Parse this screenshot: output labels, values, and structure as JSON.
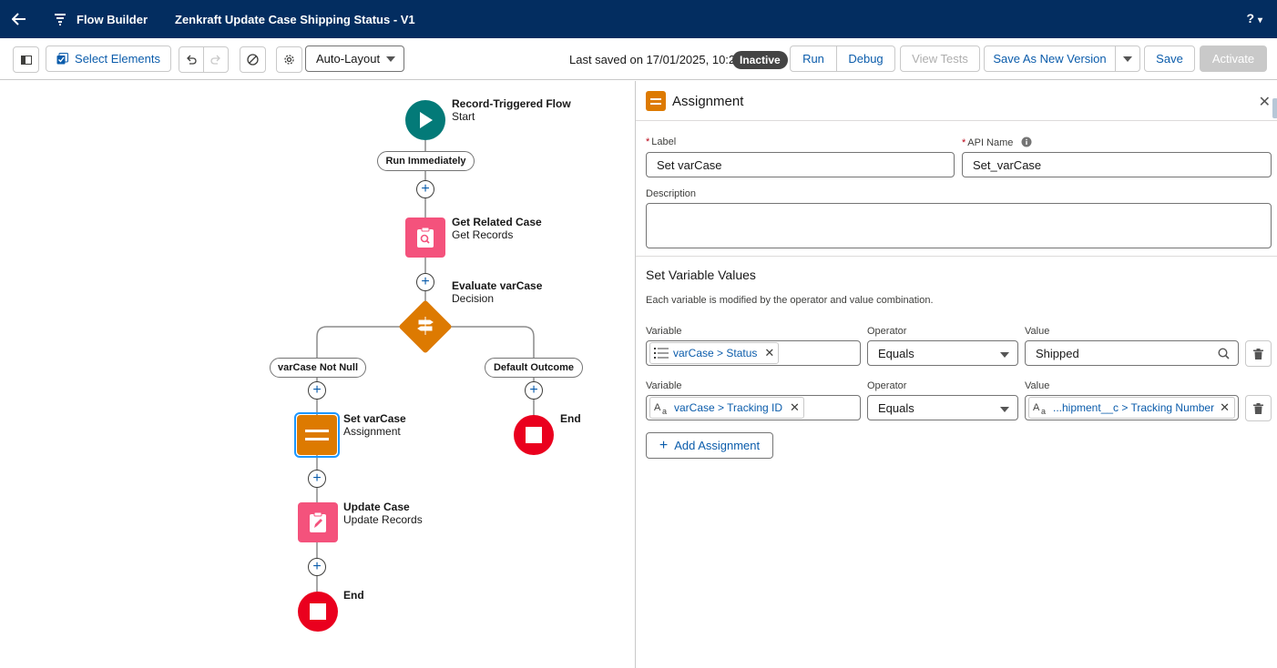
{
  "header": {
    "app_name": "Flow Builder",
    "flow_title": "Zenkraft Update Case Shipping Status - V1",
    "help_label": "?"
  },
  "toolbar": {
    "select_elements": "Select Elements",
    "layout_mode": "Auto-Layout",
    "last_saved": "Last saved on 17/01/2025, 10:26",
    "status_badge": "Inactive",
    "run": "Run",
    "debug": "Debug",
    "view_tests": "View Tests",
    "save_as_new_version": "Save As New Version",
    "save": "Save",
    "activate": "Activate"
  },
  "canvas": {
    "start": {
      "title": "Record-Triggered Flow",
      "subtitle": "Start"
    },
    "run_immediately": "Run Immediately",
    "get_records": {
      "title": "Get Related Case",
      "subtitle": "Get Records"
    },
    "decision": {
      "title": "Evaluate varCase",
      "subtitle": "Decision"
    },
    "outcome_left": "varCase Not Null",
    "outcome_right": "Default Outcome",
    "assignment": {
      "title": "Set varCase",
      "subtitle": "Assignment"
    },
    "update": {
      "title": "Update Case",
      "subtitle": "Update Records"
    },
    "end_right": "End",
    "end_bottom": "End"
  },
  "panel": {
    "title": "Assignment",
    "label_field": {
      "label": "Label",
      "value": "Set varCase"
    },
    "api_name_field": {
      "label": "API Name",
      "value": "Set_varCase"
    },
    "description_label": "Description",
    "section_title": "Set Variable Values",
    "hint": "Each variable is modified by the operator and value combination.",
    "rows": [
      {
        "variable_label": "Variable",
        "variable": "varCase > Status",
        "operator_label": "Operator",
        "operator": "Equals",
        "value_label": "Value",
        "value": "Shipped"
      },
      {
        "variable_label": "Variable",
        "variable": "varCase > Tracking ID",
        "operator_label": "Operator",
        "operator": "Equals",
        "value_label": "Value",
        "value": "...hipment__c > Tracking Number"
      }
    ],
    "add_assignment": "Add Assignment"
  },
  "colors": {
    "header_bg": "#032d60",
    "brand_blue": "#0176d3",
    "start_green": "#037a78",
    "decision_orange": "#dd7a01",
    "records_pink": "#f4527c",
    "end_red": "#ea001e",
    "inactive_badge": "#444444"
  },
  "icons": [
    "back-arrow-icon",
    "flow-builder-icon",
    "help-icon",
    "panel-toggle-icon",
    "select-elements-icon",
    "undo-icon",
    "redo-icon",
    "error-check-icon",
    "settings-icon",
    "chevron-down-icon",
    "play-icon",
    "search-record-icon",
    "decision-icon",
    "assignment-icon",
    "edit-record-icon",
    "stop-icon",
    "close-icon",
    "info-icon",
    "picklist-icon",
    "text-field-icon",
    "search-icon",
    "delete-icon",
    "add-icon"
  ]
}
